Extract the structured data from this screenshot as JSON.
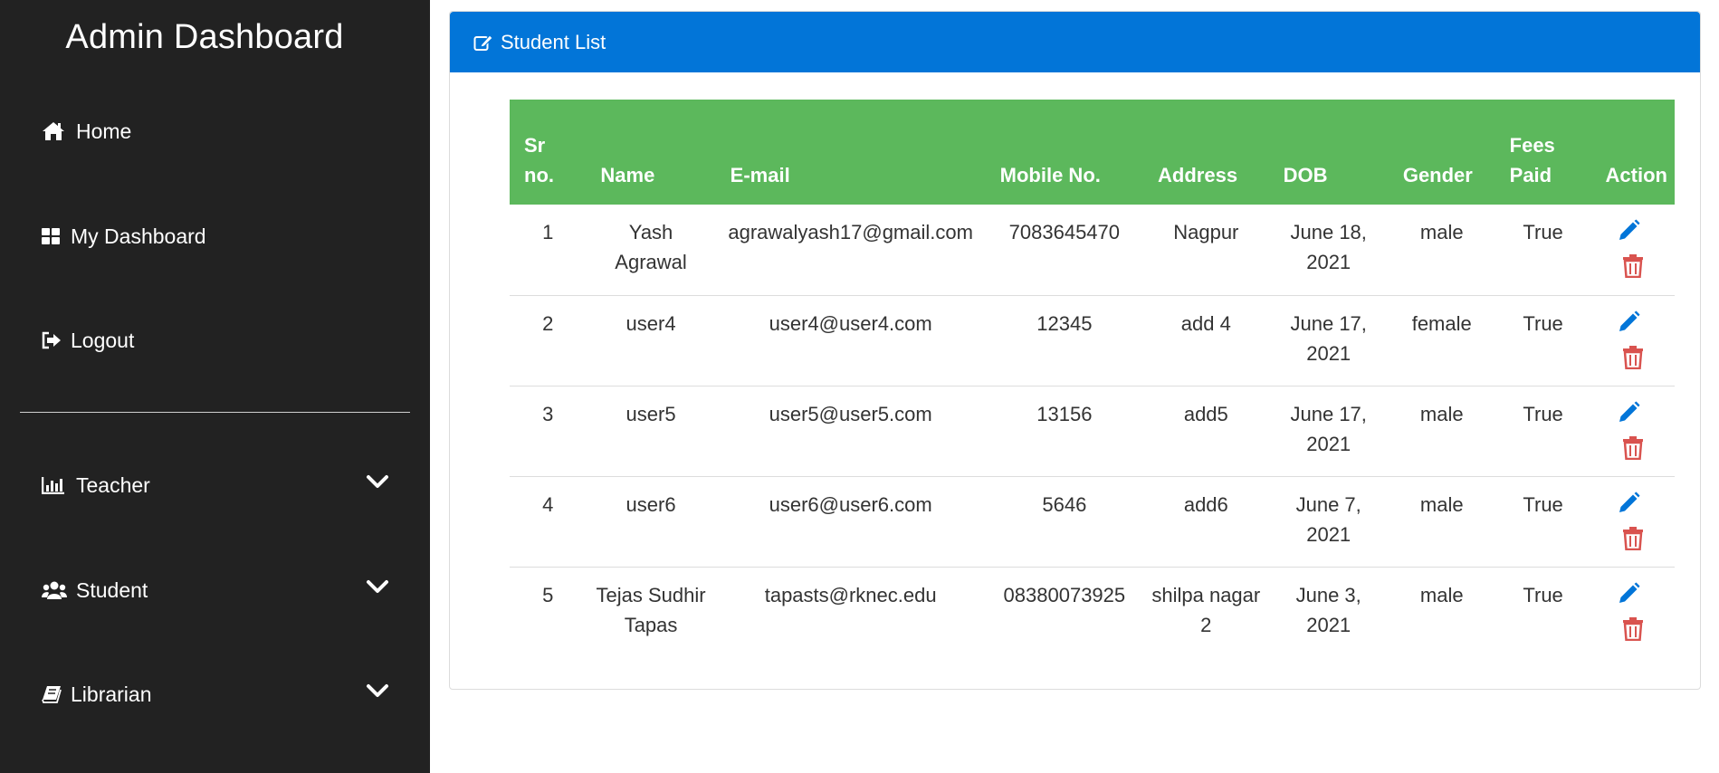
{
  "sidebar": {
    "title": "Admin Dashboard",
    "items": [
      {
        "label": "Home",
        "icon": "home-icon"
      },
      {
        "label": "My Dashboard",
        "icon": "dashboard-grid-icon"
      },
      {
        "label": "Logout",
        "icon": "logout-icon"
      },
      {
        "label": "Teacher",
        "icon": "bar-chart-icon",
        "expandable": true
      },
      {
        "label": "Student",
        "icon": "users-icon",
        "expandable": true
      },
      {
        "label": "Librarian",
        "icon": "book-icon",
        "expandable": true
      }
    ]
  },
  "panel": {
    "title": "Student List",
    "icon": "edit-icon"
  },
  "table": {
    "headers": {
      "sr_line1": "Sr",
      "sr_line2": "no.",
      "name": "Name",
      "email": "E-mail",
      "mobile": "Mobile No.",
      "address": "Address",
      "dob": "DOB",
      "gender": "Gender",
      "fees_line1": "Fees",
      "fees_line2": "Paid",
      "action": "Action"
    },
    "rows": [
      {
        "sr": "1",
        "name": "Yash Agrawal",
        "email": "agrawalyash17@gmail.com",
        "mobile": "7083645470",
        "address": "Nagpur",
        "dob": "June 18, 2021",
        "gender": "male",
        "fees": "True"
      },
      {
        "sr": "2",
        "name": "user4",
        "email": "user4@user4.com",
        "mobile": "12345",
        "address": "add 4",
        "dob": "June 17, 2021",
        "gender": "female",
        "fees": "True"
      },
      {
        "sr": "3",
        "name": "user5",
        "email": "user5@user5.com",
        "mobile": "13156",
        "address": "add5",
        "dob": "June 17, 2021",
        "gender": "male",
        "fees": "True"
      },
      {
        "sr": "4",
        "name": "user6",
        "email": "user6@user6.com",
        "mobile": "5646",
        "address": "add6",
        "dob": "June 7, 2021",
        "gender": "male",
        "fees": "True"
      },
      {
        "sr": "5",
        "name": "Tejas Sudhir Tapas",
        "email": "tapasts@rknec.edu",
        "mobile": "08380073925",
        "address": "shilpa nagar 2",
        "dob": "June 3, 2021",
        "gender": "male",
        "fees": "True"
      }
    ]
  },
  "colors": {
    "sidebar_bg": "#222222",
    "header_blue": "#0275d8",
    "table_header_green": "#5cb85c",
    "edit_icon": "#0275d8",
    "delete_icon": "#d9534f"
  }
}
